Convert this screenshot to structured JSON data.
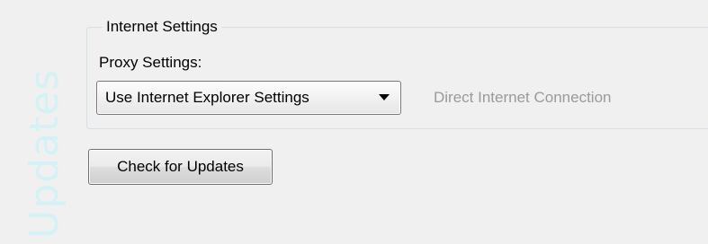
{
  "side_title": "Updates",
  "internet_settings": {
    "group_label": "Internet Settings",
    "proxy_label": "Proxy Settings:",
    "proxy_selected": "Use Internet Explorer Settings",
    "connection_status": "Direct Internet Connection"
  },
  "actions": {
    "check_updates_label": "Check for Updates"
  },
  "colors": {
    "side_title": "#d4f2f6",
    "background": "#f0f0f0",
    "status_text": "#9a9a9a"
  }
}
